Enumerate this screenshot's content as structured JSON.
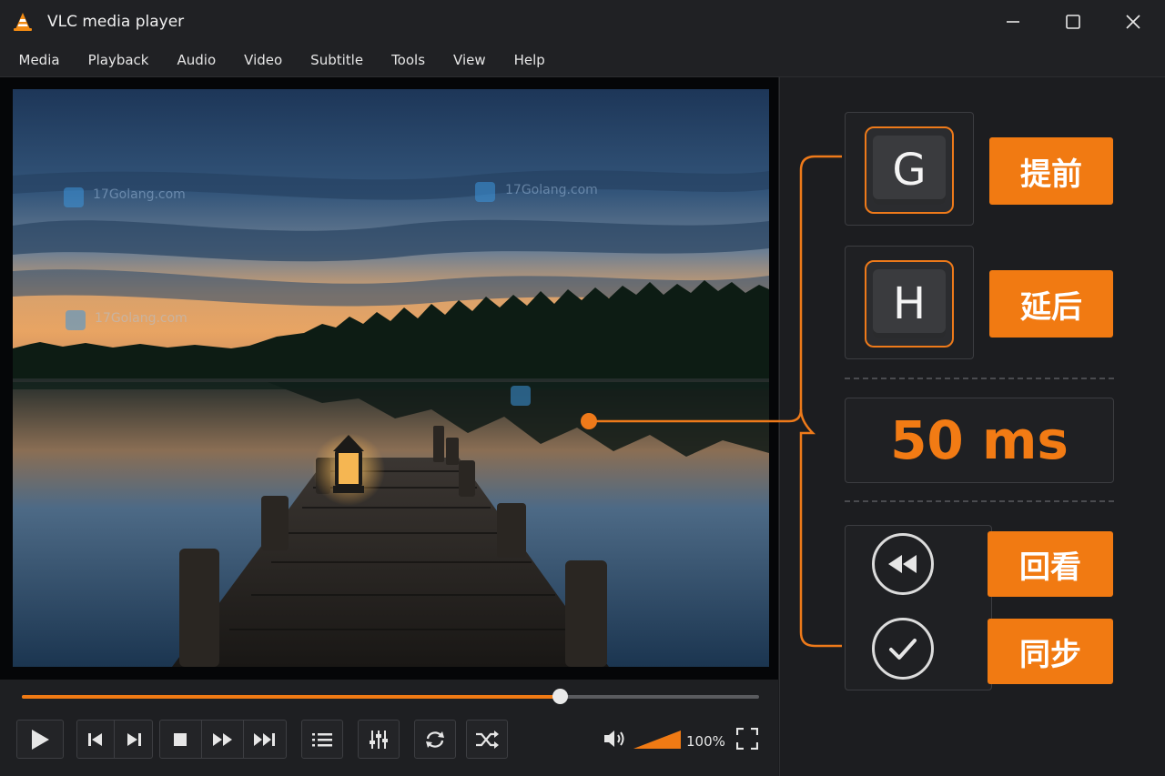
{
  "window": {
    "title": "VLC media player"
  },
  "menu": {
    "items": [
      "Media",
      "Playback",
      "Audio",
      "Video",
      "Subtitle",
      "Tools",
      "View",
      "Help"
    ]
  },
  "panel": {
    "key_advance": {
      "key": "G",
      "label": "提前"
    },
    "key_delay": {
      "key": "H",
      "label": "延后"
    },
    "delay_value": "50 ms",
    "review_label": "回看",
    "sync_label": "同步"
  },
  "playback": {
    "progress": 0.73,
    "volume_label": "100%",
    "volume_level": 1.0
  },
  "watermark": {
    "text": "17Golang.com"
  },
  "icons": [
    "vlc-cone-icon",
    "minimize-icon",
    "maximize-icon",
    "close-icon",
    "play-icon",
    "previous-icon",
    "next-icon",
    "stop-icon",
    "fast-forward-icon",
    "skip-forward-icon",
    "playlist-icon",
    "equalizer-icon",
    "loop-icon",
    "shuffle-icon",
    "volume-icon",
    "fullscreen-icon",
    "rewind-icon",
    "check-icon"
  ],
  "colors": {
    "accent": "#f07a14",
    "background": "#1c1d20"
  }
}
